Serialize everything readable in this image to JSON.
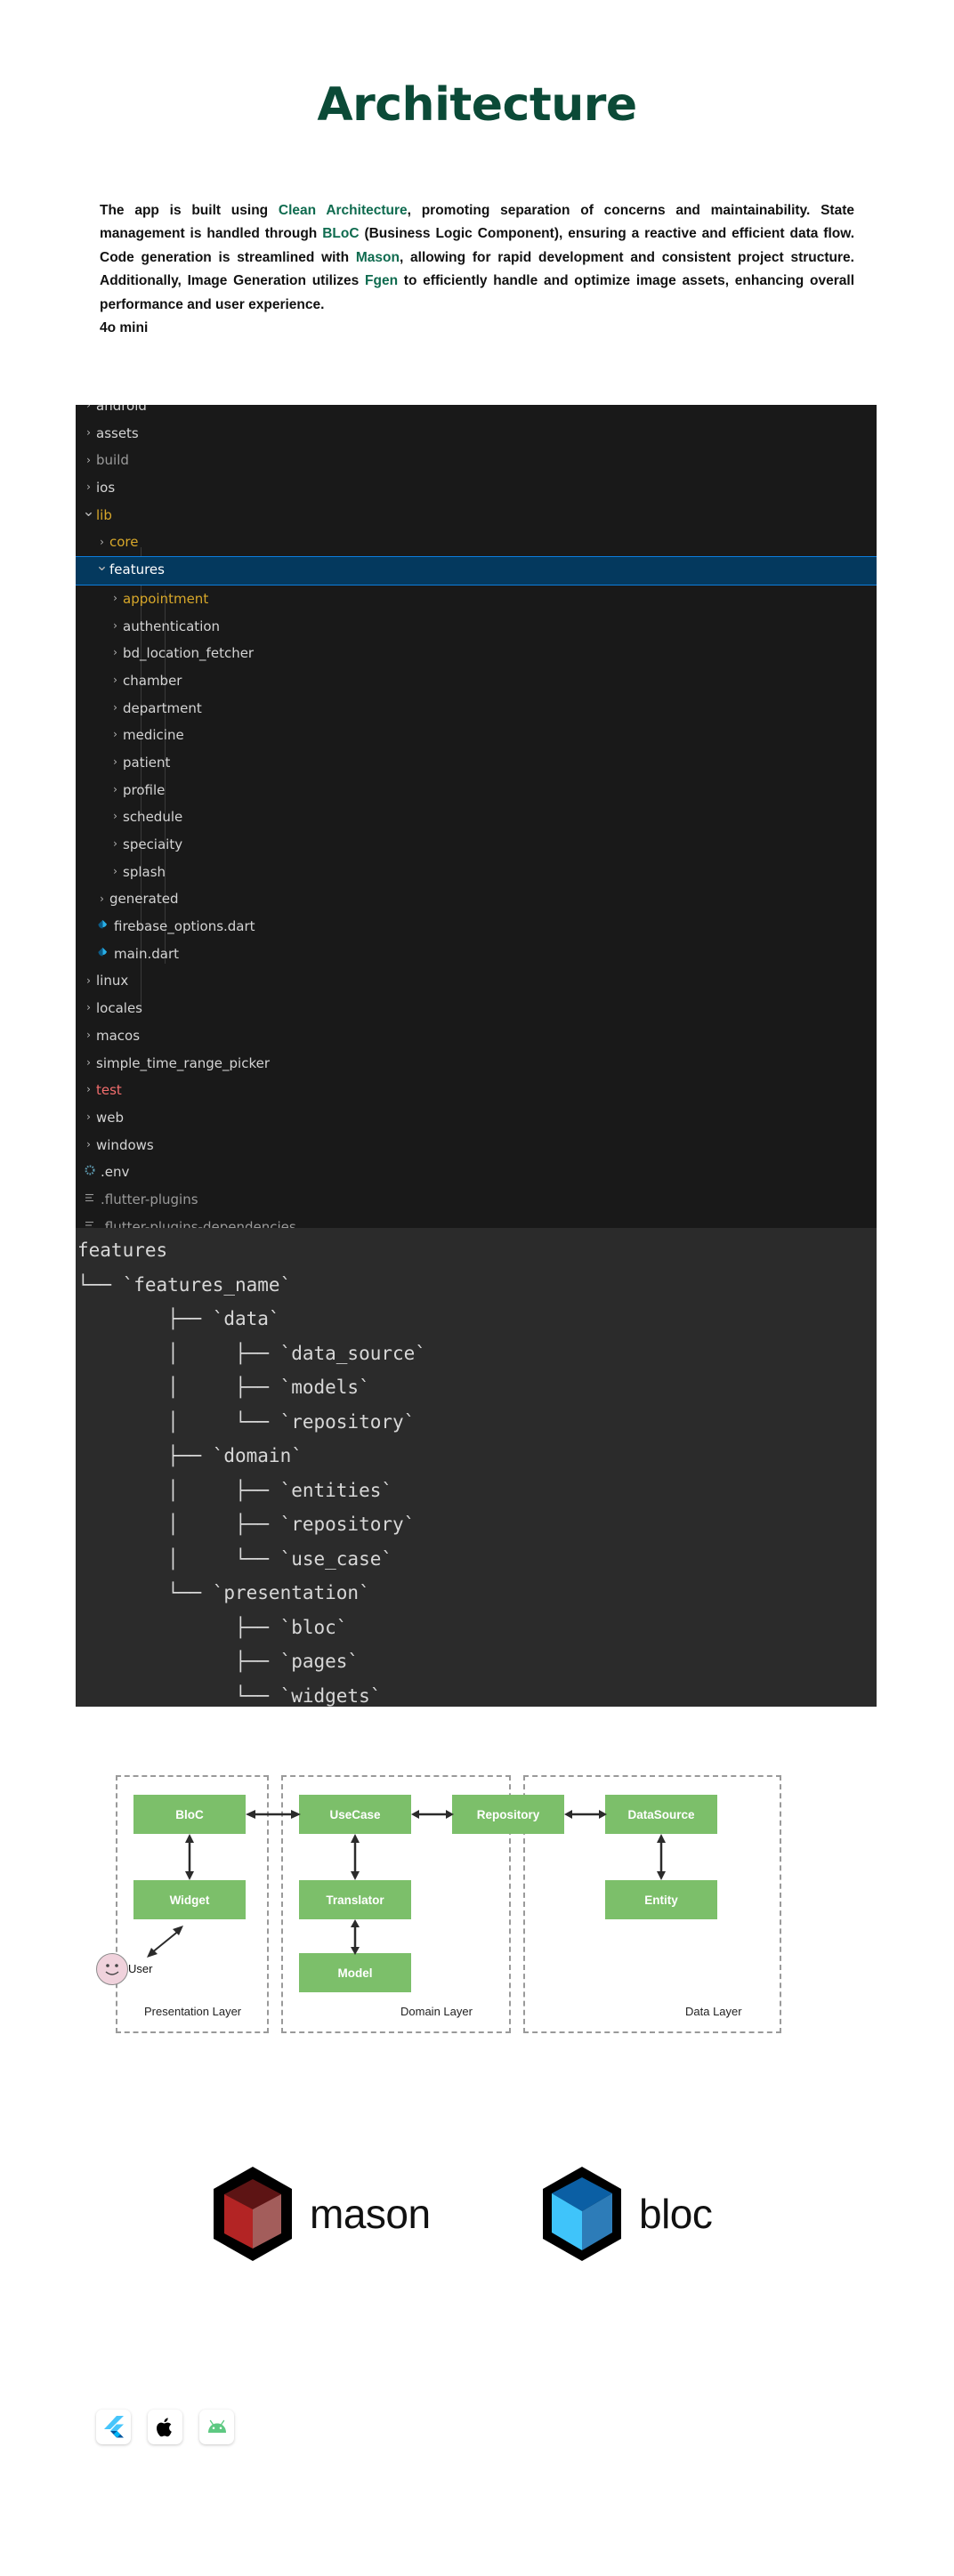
{
  "header": {
    "title": "Architecture",
    "title_color": "#0b4a37"
  },
  "intro": {
    "segments": [
      {
        "text": "The app is built using ",
        "highlight": false
      },
      {
        "text": "Clean Architecture",
        "highlight": true
      },
      {
        "text": ", promoting separation of concerns and maintainability. State management is handled through ",
        "highlight": false
      },
      {
        "text": "BLoC",
        "highlight": true
      },
      {
        "text": " (Business Logic Component), ensuring a reactive and efficient data flow. Code generation is streamlined with ",
        "highlight": false
      },
      {
        "text": "Mason",
        "highlight": true
      },
      {
        "text": ", allowing for rapid development and consistent project structure. Additionally, Image Generation utilizes ",
        "highlight": false
      },
      {
        "text": "Fgen",
        "highlight": true
      },
      {
        "text": " to efficiently handle and optimize image assets, enhancing overall performance and user experience.",
        "highlight": false
      }
    ],
    "model_tag": "4o mini",
    "highlight_color": "#0f6b4f"
  },
  "file_tree": {
    "background": "#191919",
    "selection_color": "#04395e",
    "selection_border": "#0d7ddb",
    "rows": [
      {
        "label": "android",
        "indent": 0,
        "chevron": "right",
        "color": "c-norm",
        "clipped": true
      },
      {
        "label": "assets",
        "indent": 0,
        "chevron": "right",
        "color": "c-norm"
      },
      {
        "label": "build",
        "indent": 0,
        "chevron": "right",
        "color": "c-dim"
      },
      {
        "label": "ios",
        "indent": 0,
        "chevron": "right",
        "color": "c-norm"
      },
      {
        "label": "lib",
        "indent": 0,
        "chevron": "down",
        "color": "c-gold"
      },
      {
        "label": "core",
        "indent": 1,
        "chevron": "right",
        "color": "c-gold"
      },
      {
        "label": "features",
        "indent": 1,
        "chevron": "down",
        "color": "c-white",
        "selected": true
      },
      {
        "label": "appointment",
        "indent": 2,
        "chevron": "right",
        "color": "c-gold"
      },
      {
        "label": "authentication",
        "indent": 2,
        "chevron": "right",
        "color": "c-norm"
      },
      {
        "label": "bd_location_fetcher",
        "indent": 2,
        "chevron": "right",
        "color": "c-norm"
      },
      {
        "label": "chamber",
        "indent": 2,
        "chevron": "right",
        "color": "c-norm"
      },
      {
        "label": "department",
        "indent": 2,
        "chevron": "right",
        "color": "c-norm"
      },
      {
        "label": "medicine",
        "indent": 2,
        "chevron": "right",
        "color": "c-norm"
      },
      {
        "label": "patient",
        "indent": 2,
        "chevron": "right",
        "color": "c-norm"
      },
      {
        "label": "profile",
        "indent": 2,
        "chevron": "right",
        "color": "c-norm"
      },
      {
        "label": "schedule",
        "indent": 2,
        "chevron": "right",
        "color": "c-norm"
      },
      {
        "label": "speciaity",
        "indent": 2,
        "chevron": "right",
        "color": "c-norm"
      },
      {
        "label": "splash",
        "indent": 2,
        "chevron": "right",
        "color": "c-norm"
      },
      {
        "label": "generated",
        "indent": 1,
        "chevron": "right",
        "color": "c-norm"
      },
      {
        "label": "firebase_options.dart",
        "indent": 1,
        "chevron": "none",
        "color": "c-norm",
        "icon": "dart-file-icon"
      },
      {
        "label": "main.dart",
        "indent": 1,
        "chevron": "none",
        "color": "c-norm",
        "icon": "dart-file-icon"
      },
      {
        "label": "linux",
        "indent": 0,
        "chevron": "right",
        "color": "c-norm"
      },
      {
        "label": "locales",
        "indent": 0,
        "chevron": "right",
        "color": "c-norm"
      },
      {
        "label": "macos",
        "indent": 0,
        "chevron": "right",
        "color": "c-norm"
      },
      {
        "label": "simple_time_range_picker",
        "indent": 0,
        "chevron": "right",
        "color": "c-norm"
      },
      {
        "label": "test",
        "indent": 0,
        "chevron": "right",
        "color": "c-red"
      },
      {
        "label": "web",
        "indent": 0,
        "chevron": "right",
        "color": "c-norm"
      },
      {
        "label": "windows",
        "indent": 0,
        "chevron": "right",
        "color": "c-norm"
      },
      {
        "label": ".env",
        "indent": 0,
        "chevron": "none",
        "color": "c-norm",
        "icon": "gear-icon"
      },
      {
        "label": ".flutter-plugins",
        "indent": 0,
        "chevron": "none",
        "color": "c-dim",
        "icon": "settings-list-icon"
      },
      {
        "label": ".flutter-plugins-dependencies",
        "indent": 0,
        "chevron": "none",
        "color": "c-dim",
        "icon": "settings-list-icon"
      }
    ]
  },
  "ascii_tree": {
    "background": "#2b2b2b",
    "lines": [
      "features",
      "└── `features_name`",
      "        ├── `data`",
      "        │     ├── `data_source`",
      "        │     ├── `models`",
      "        │     └── `repository`",
      "        ├── `domain`",
      "        │     ├── `entities`",
      "        │     ├── `repository`",
      "        │     └── `use_case`",
      "        └── `presentation`",
      "              ├── `bloc`",
      "              ├── `pages`",
      "              └── `widgets`"
    ]
  },
  "architecture_diagram": {
    "node_color": "#7cbf6a",
    "border_style": "dashed",
    "layers": [
      {
        "name": "Presentation Layer",
        "label": "Presentation Layer"
      },
      {
        "name": "Domain Layer",
        "label": "Domain Layer"
      },
      {
        "name": "Data Layer",
        "label": "Data Layer"
      }
    ],
    "nodes": [
      {
        "label": "BloC",
        "layer": "Presentation Layer"
      },
      {
        "label": "Widget",
        "layer": "Presentation Layer"
      },
      {
        "label": "UseCase",
        "layer": "Domain Layer"
      },
      {
        "label": "Translator",
        "layer": "Domain Layer"
      },
      {
        "label": "Model",
        "layer": "Domain Layer"
      },
      {
        "label": "Repository",
        "layer": "Domain Layer"
      },
      {
        "label": "DataSource",
        "layer": "Data Layer"
      },
      {
        "label": "Entity",
        "layer": "Data Layer"
      }
    ],
    "actor": {
      "label": "User"
    }
  },
  "brands": [
    {
      "name": "mason",
      "logo": "mason-cube-logo",
      "color": "#b32424"
    },
    {
      "name": "bloc",
      "logo": "bloc-cube-logo",
      "color": "#2ab7f7"
    }
  ],
  "platforms": [
    {
      "name": "flutter-icon",
      "color": "#42a5f5"
    },
    {
      "name": "apple-icon",
      "color": "#000000"
    },
    {
      "name": "android-icon",
      "color": "#5ec982"
    }
  ]
}
